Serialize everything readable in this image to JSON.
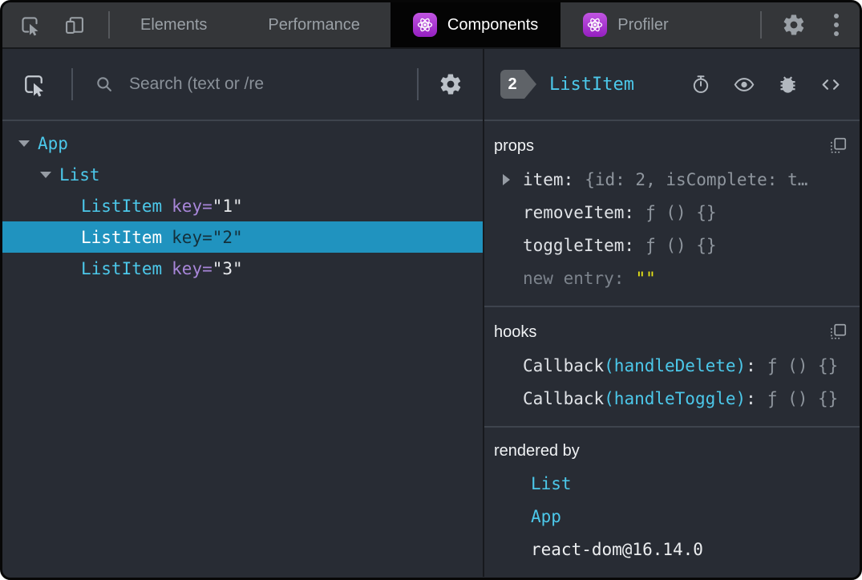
{
  "colors": {
    "accent_cyan": "#4cc8ea",
    "key_purple": "#a886d9",
    "selected_row_bg": "#2093bf",
    "react_purple": "#a62ed3",
    "string_yellow": "#e8e516",
    "panel_bg": "#282c34",
    "tabbar_bg": "#343639",
    "selected_tab_bg": "#040404"
  },
  "tabbar": {
    "tabs": [
      {
        "label": "Elements",
        "selected": false,
        "icon": null
      },
      {
        "label": "Performance",
        "selected": false,
        "icon": null
      },
      {
        "label": "Components",
        "selected": true,
        "icon": "react-logo"
      },
      {
        "label": "Profiler",
        "selected": false,
        "icon": "react-logo"
      }
    ],
    "left_icons": [
      "inspect-icon",
      "device-toolbar-icon"
    ],
    "right_icons": [
      "gear-icon",
      "kebab-menu-icon"
    ]
  },
  "left_panel": {
    "toolbar": {
      "select_icon": "select-element-icon",
      "search_icon": "search-icon",
      "search_placeholder": "Search (text or /re",
      "settings_icon": "gear-icon"
    },
    "tree": [
      {
        "name": "App",
        "depth": 0,
        "expanded": true,
        "attr": "",
        "val": "",
        "selected": false
      },
      {
        "name": "List",
        "depth": 1,
        "expanded": true,
        "attr": "",
        "val": "",
        "selected": false
      },
      {
        "name": "ListItem",
        "depth": 2,
        "expanded": false,
        "attr": "key=",
        "val": "\"1\"",
        "selected": false
      },
      {
        "name": "ListItem",
        "depth": 2,
        "expanded": false,
        "attr": "key=",
        "val": "\"2\"",
        "selected": true
      },
      {
        "name": "ListItem",
        "depth": 2,
        "expanded": false,
        "attr": "key=",
        "val": "\"3\"",
        "selected": false
      }
    ]
  },
  "right_panel": {
    "header": {
      "badge": "2",
      "component": "ListItem",
      "icons": [
        "stopwatch-suspense-icon",
        "inspect-dom-eye-icon",
        "log-data-bug-icon",
        "view-source-icon"
      ]
    },
    "props": {
      "title": "props",
      "copy_icon": "copy-icon",
      "rows": [
        {
          "name": "item:",
          "value": "{id: 2, isComplete: t…",
          "expandable": true
        },
        {
          "name": "removeItem:",
          "value": "ƒ () {}",
          "expandable": false
        },
        {
          "name": "toggleItem:",
          "value": "ƒ () {}",
          "expandable": false
        },
        {
          "name": "new entry:",
          "value": "\"\"",
          "is_new_entry": true
        }
      ]
    },
    "hooks": {
      "title": "hooks",
      "copy_icon": "copy-icon",
      "rows": [
        {
          "name": "Callback",
          "target": "(handleDelete)",
          "colon": ":",
          "value": "ƒ () {}"
        },
        {
          "name": "Callback",
          "target": "(handleToggle)",
          "colon": ":",
          "value": "ƒ () {}"
        }
      ]
    },
    "rendered_by": {
      "title": "rendered by",
      "items": [
        {
          "label": "List",
          "link": true
        },
        {
          "label": "App",
          "link": true
        },
        {
          "label": "react-dom@16.14.0",
          "link": false
        }
      ]
    }
  }
}
